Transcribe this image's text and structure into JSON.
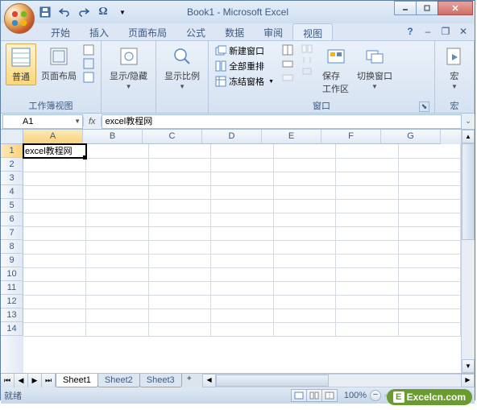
{
  "title": "Book1 - Microsoft Excel",
  "qat": {
    "save": "💾",
    "undo": "↶",
    "redo": "↷",
    "omega": "Ω"
  },
  "tabs": {
    "items": [
      "开始",
      "插入",
      "页面布局",
      "公式",
      "数据",
      "审阅",
      "视图"
    ],
    "active_index": 6
  },
  "ribbon": {
    "group_views": {
      "label": "工作簿视图",
      "normal": "普通",
      "pagelayout": "页面布局"
    },
    "group_showhide": {
      "label": "显示/隐藏"
    },
    "group_zoom": {
      "label": "显示比例"
    },
    "group_window": {
      "label": "窗口",
      "newwin": "新建窗口",
      "arrange": "全部重排",
      "freeze": "冻结窗格",
      "savews": "保存\n工作区",
      "switchwin": "切换窗口"
    },
    "group_macros": {
      "label": "宏",
      "macros": "宏"
    }
  },
  "namebox": "A1",
  "formula": "excel教程网",
  "columns": [
    "A",
    "B",
    "C",
    "D",
    "E",
    "F",
    "G"
  ],
  "rows": [
    "1",
    "2",
    "3",
    "4",
    "5",
    "6",
    "7",
    "8",
    "9",
    "10",
    "11",
    "12",
    "13",
    "14"
  ],
  "active_cell": {
    "row": 0,
    "col": 0,
    "value": "excel教程网"
  },
  "sheets": [
    "Sheet1",
    "Sheet2",
    "Sheet3"
  ],
  "active_sheet": 0,
  "status": "就绪",
  "zoom": "100%",
  "watermark": "Excelcn.com"
}
